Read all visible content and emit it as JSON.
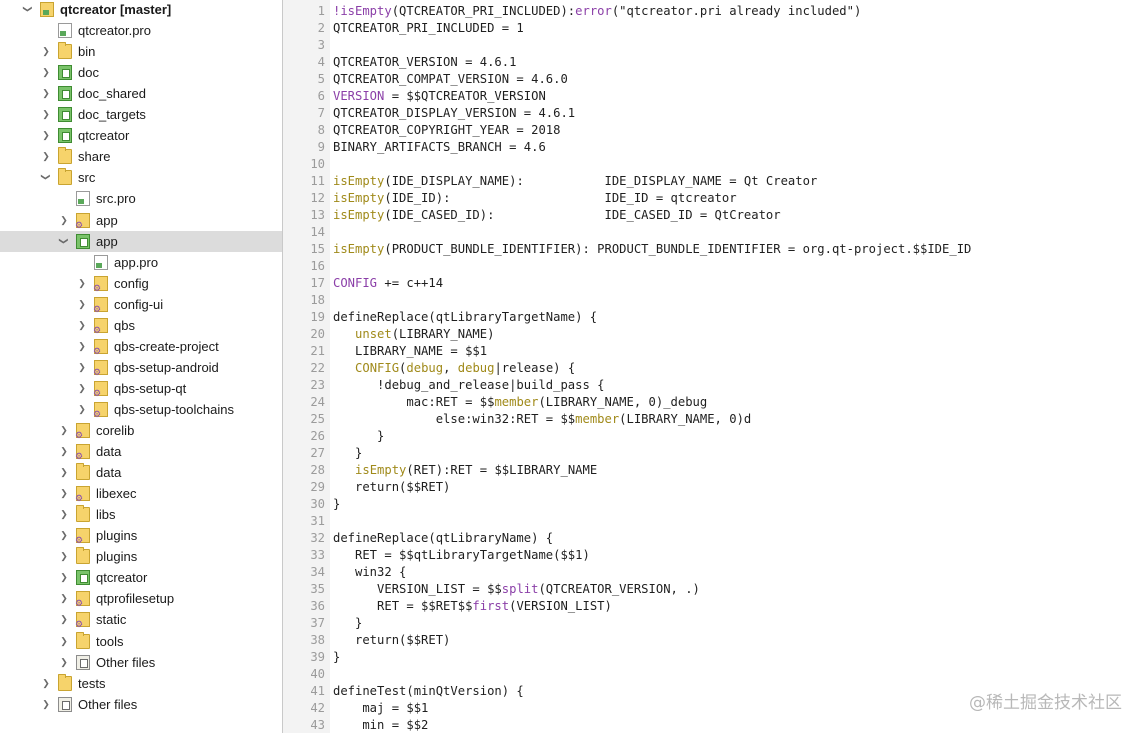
{
  "tree": {
    "items": [
      {
        "label": "qtcreator [master]",
        "depth": 0,
        "arrow": "expanded",
        "icon": "root-project-icon",
        "bold": true
      },
      {
        "label": "qtcreator.pro",
        "depth": 1,
        "arrow": "none",
        "icon": "pro-file-icon"
      },
      {
        "label": "bin",
        "depth": 1,
        "arrow": "collapsed",
        "icon": "folder-icon"
      },
      {
        "label": "doc",
        "depth": 1,
        "arrow": "collapsed",
        "icon": "doc-folder-icon"
      },
      {
        "label": "doc_shared",
        "depth": 1,
        "arrow": "collapsed",
        "icon": "doc-folder-icon"
      },
      {
        "label": "doc_targets",
        "depth": 1,
        "arrow": "collapsed",
        "icon": "doc-folder-icon"
      },
      {
        "label": "qtcreator",
        "depth": 1,
        "arrow": "collapsed",
        "icon": "doc-folder-icon"
      },
      {
        "label": "share",
        "depth": 1,
        "arrow": "collapsed",
        "icon": "folder-icon"
      },
      {
        "label": "src",
        "depth": 1,
        "arrow": "expanded",
        "icon": "folder-icon"
      },
      {
        "label": "src.pro",
        "depth": 2,
        "arrow": "none",
        "icon": "pro-file-icon"
      },
      {
        "label": "app",
        "depth": 2,
        "arrow": "collapsed",
        "icon": "gear-folder-icon"
      },
      {
        "label": "app",
        "depth": 2,
        "arrow": "expanded",
        "icon": "project-folder-icon",
        "selected": true
      },
      {
        "label": "app.pro",
        "depth": 3,
        "arrow": "none",
        "icon": "pro-file-icon"
      },
      {
        "label": "config",
        "depth": 3,
        "arrow": "collapsed",
        "icon": "gear-folder-icon"
      },
      {
        "label": "config-ui",
        "depth": 3,
        "arrow": "collapsed",
        "icon": "gear-folder-icon"
      },
      {
        "label": "qbs",
        "depth": 3,
        "arrow": "collapsed",
        "icon": "gear-folder-icon"
      },
      {
        "label": "qbs-create-project",
        "depth": 3,
        "arrow": "collapsed",
        "icon": "gear-folder-icon"
      },
      {
        "label": "qbs-setup-android",
        "depth": 3,
        "arrow": "collapsed",
        "icon": "gear-folder-icon"
      },
      {
        "label": "qbs-setup-qt",
        "depth": 3,
        "arrow": "collapsed",
        "icon": "gear-folder-icon"
      },
      {
        "label": "qbs-setup-toolchains",
        "depth": 3,
        "arrow": "collapsed",
        "icon": "gear-folder-icon"
      },
      {
        "label": "corelib",
        "depth": 2,
        "arrow": "collapsed",
        "icon": "gear-folder-icon"
      },
      {
        "label": "data",
        "depth": 2,
        "arrow": "collapsed",
        "icon": "gear-folder-icon"
      },
      {
        "label": "data",
        "depth": 2,
        "arrow": "collapsed",
        "icon": "folder-icon"
      },
      {
        "label": "libexec",
        "depth": 2,
        "arrow": "collapsed",
        "icon": "gear-folder-icon"
      },
      {
        "label": "libs",
        "depth": 2,
        "arrow": "collapsed",
        "icon": "folder-icon"
      },
      {
        "label": "plugins",
        "depth": 2,
        "arrow": "collapsed",
        "icon": "gear-folder-icon"
      },
      {
        "label": "plugins",
        "depth": 2,
        "arrow": "collapsed",
        "icon": "folder-icon"
      },
      {
        "label": "qtcreator",
        "depth": 2,
        "arrow": "collapsed",
        "icon": "doc-folder-icon"
      },
      {
        "label": "qtprofilesetup",
        "depth": 2,
        "arrow": "collapsed",
        "icon": "gear-folder-icon"
      },
      {
        "label": "static",
        "depth": 2,
        "arrow": "collapsed",
        "icon": "gear-folder-icon"
      },
      {
        "label": "tools",
        "depth": 2,
        "arrow": "collapsed",
        "icon": "folder-icon"
      },
      {
        "label": "Other files",
        "depth": 2,
        "arrow": "collapsed",
        "icon": "other-files-icon"
      },
      {
        "label": "tests",
        "depth": 1,
        "arrow": "collapsed",
        "icon": "folder-icon"
      },
      {
        "label": "Other files",
        "depth": 1,
        "arrow": "collapsed",
        "icon": "other-files-icon"
      }
    ]
  },
  "editor": {
    "lines": [
      {
        "n": "1",
        "segs": [
          [
            "kw",
            "!isEmpty"
          ],
          [
            "",
            "(QTCREATOR_PRI_INCLUDED):"
          ],
          [
            "kw",
            "error"
          ],
          [
            "",
            "(\"qtcreator.pri already included\")"
          ]
        ]
      },
      {
        "n": "2",
        "segs": [
          [
            "",
            "QTCREATOR_PRI_INCLUDED = 1"
          ]
        ]
      },
      {
        "n": "3",
        "segs": []
      },
      {
        "n": "4",
        "segs": [
          [
            "",
            "QTCREATOR_VERSION = 4.6.1"
          ]
        ]
      },
      {
        "n": "5",
        "segs": [
          [
            "",
            "QTCREATOR_COMPAT_VERSION = 4.6.0"
          ]
        ]
      },
      {
        "n": "6",
        "segs": [
          [
            "kw",
            "VERSION"
          ],
          [
            "",
            " = $$QTCREATOR_VERSION"
          ]
        ]
      },
      {
        "n": "7",
        "segs": [
          [
            "",
            "QTCREATOR_DISPLAY_VERSION = 4.6.1"
          ]
        ]
      },
      {
        "n": "8",
        "segs": [
          [
            "",
            "QTCREATOR_COPYRIGHT_YEAR = 2018"
          ]
        ]
      },
      {
        "n": "9",
        "segs": [
          [
            "",
            "BINARY_ARTIFACTS_BRANCH = 4.6"
          ]
        ]
      },
      {
        "n": "10",
        "segs": []
      },
      {
        "n": "11",
        "segs": [
          [
            "fn",
            "isEmpty"
          ],
          [
            "",
            "(IDE_DISPLAY_NAME):           IDE_DISPLAY_NAME = Qt Creator"
          ]
        ]
      },
      {
        "n": "12",
        "segs": [
          [
            "fn",
            "isEmpty"
          ],
          [
            "",
            "(IDE_ID):                     IDE_ID = qtcreator"
          ]
        ]
      },
      {
        "n": "13",
        "segs": [
          [
            "fn",
            "isEmpty"
          ],
          [
            "",
            "(IDE_CASED_ID):               IDE_CASED_ID = QtCreator"
          ]
        ]
      },
      {
        "n": "14",
        "segs": []
      },
      {
        "n": "15",
        "segs": [
          [
            "fn",
            "isEmpty"
          ],
          [
            "",
            "(PRODUCT_BUNDLE_IDENTIFIER): PRODUCT_BUNDLE_IDENTIFIER = org.qt-project.$$IDE_ID"
          ]
        ]
      },
      {
        "n": "16",
        "segs": []
      },
      {
        "n": "17",
        "segs": [
          [
            "kw",
            "CONFIG"
          ],
          [
            "",
            " += c++14"
          ]
        ]
      },
      {
        "n": "18",
        "segs": []
      },
      {
        "n": "19",
        "segs": [
          [
            "",
            "defineReplace(qtLibraryTargetName) {"
          ]
        ]
      },
      {
        "n": "20",
        "segs": [
          [
            "",
            "   "
          ],
          [
            "fn",
            "unset"
          ],
          [
            "",
            "(LIBRARY_NAME)"
          ]
        ]
      },
      {
        "n": "21",
        "segs": [
          [
            "",
            "   LIBRARY_NAME = $$1"
          ]
        ]
      },
      {
        "n": "22",
        "segs": [
          [
            "",
            "   "
          ],
          [
            "fn",
            "CONFIG"
          ],
          [
            "",
            "("
          ],
          [
            "fn",
            "debug"
          ],
          [
            "",
            ", "
          ],
          [
            "fn",
            "debug"
          ],
          [
            "",
            "|release) {"
          ]
        ]
      },
      {
        "n": "23",
        "segs": [
          [
            "",
            "      !debug_and_release|build_pass {"
          ]
        ]
      },
      {
        "n": "24",
        "segs": [
          [
            "",
            "          mac:RET = $$"
          ],
          [
            "fn",
            "member"
          ],
          [
            "",
            "(LIBRARY_NAME, 0)_debug"
          ]
        ]
      },
      {
        "n": "25",
        "segs": [
          [
            "",
            "              else:win32:RET = $$"
          ],
          [
            "fn",
            "member"
          ],
          [
            "",
            "(LIBRARY_NAME, 0)d"
          ]
        ]
      },
      {
        "n": "26",
        "segs": [
          [
            "",
            "      }"
          ]
        ]
      },
      {
        "n": "27",
        "segs": [
          [
            "",
            "   }"
          ]
        ]
      },
      {
        "n": "28",
        "segs": [
          [
            "",
            "   "
          ],
          [
            "fn",
            "isEmpty"
          ],
          [
            "",
            "(RET):RET = $$LIBRARY_NAME"
          ]
        ]
      },
      {
        "n": "29",
        "segs": [
          [
            "",
            "   return($$RET)"
          ]
        ]
      },
      {
        "n": "30",
        "segs": [
          [
            "",
            "}"
          ]
        ]
      },
      {
        "n": "31",
        "segs": []
      },
      {
        "n": "32",
        "segs": [
          [
            "",
            "defineReplace(qtLibraryName) {"
          ]
        ]
      },
      {
        "n": "33",
        "segs": [
          [
            "",
            "   RET = $$qtLibraryTargetName($$1)"
          ]
        ]
      },
      {
        "n": "34",
        "segs": [
          [
            "",
            "   win32 {"
          ]
        ]
      },
      {
        "n": "35",
        "segs": [
          [
            "",
            "      VERSION_LIST = $$"
          ],
          [
            "fnpurple",
            "split"
          ],
          [
            "",
            "(QTCREATOR_VERSION, .)"
          ]
        ]
      },
      {
        "n": "36",
        "segs": [
          [
            "",
            "      RET = $$RET$$"
          ],
          [
            "fnpurple",
            "first"
          ],
          [
            "",
            "(VERSION_LIST)"
          ]
        ]
      },
      {
        "n": "37",
        "segs": [
          [
            "",
            "   }"
          ]
        ]
      },
      {
        "n": "38",
        "segs": [
          [
            "",
            "   return($$RET)"
          ]
        ]
      },
      {
        "n": "39",
        "segs": [
          [
            "",
            "}"
          ]
        ]
      },
      {
        "n": "40",
        "segs": []
      },
      {
        "n": "41",
        "segs": [
          [
            "",
            "defineTest(minQtVersion) {"
          ]
        ]
      },
      {
        "n": "42",
        "segs": [
          [
            "",
            "    maj = $$1"
          ]
        ]
      },
      {
        "n": "43",
        "segs": [
          [
            "",
            "    min = $$2"
          ]
        ]
      }
    ]
  },
  "watermark": "@稀土掘金技术社区"
}
